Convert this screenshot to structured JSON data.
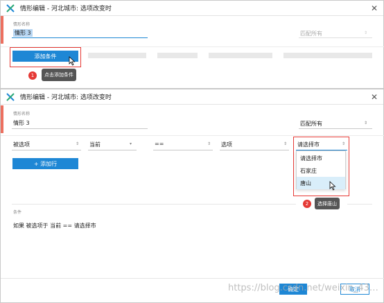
{
  "colors": {
    "accent": "#ec7060",
    "primary": "#1e87d5",
    "highlight": "#e53935"
  },
  "top_dialog": {
    "title": "情形编辑  -  河北城市: 选项改变时",
    "name_label": "情形名称",
    "name_value": "情形 3",
    "match_value": "匹配所有",
    "add_condition_label": "添加条件",
    "step_number": "1",
    "step_tooltip": "点击添加条件"
  },
  "main_dialog": {
    "title": "情形编辑  -  河北城市: 选项改变时",
    "name_label": "情形名称",
    "name_value": "情形 3",
    "match_value": "匹配所有",
    "condition_row": {
      "subject": "被选项",
      "scope": "当前",
      "operator": "==",
      "value_type": "选项",
      "value": "请选择市"
    },
    "dropdown_options": [
      "请选择市",
      "石家庄",
      "唐山"
    ],
    "highlighted_option": "唐山",
    "add_row_label": "+ 添加行",
    "step_number": "2",
    "step_tooltip": "选择唐山",
    "conditions_header": "条件",
    "conditions_summary": "如果  被选项于 当前 == 请选择市",
    "ok_label": "确定",
    "cancel_label": "取消",
    "watermark": "https://blog.csdn.net/weixin_43…"
  }
}
